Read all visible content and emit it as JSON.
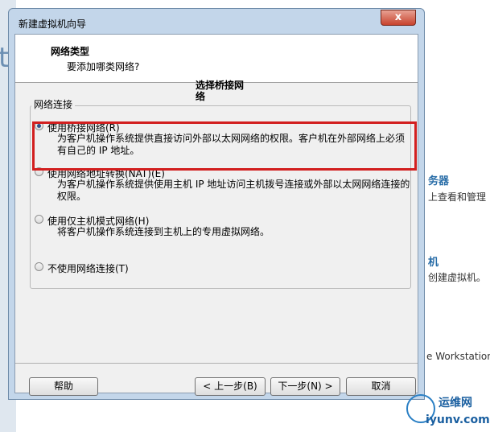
{
  "window": {
    "title": "新建虚拟机向导",
    "close_label": "x"
  },
  "header": {
    "title": "网络类型",
    "subtitle": "要添加哪类网络?"
  },
  "annotation": "选择桥接网络",
  "group": {
    "label": "网络连接"
  },
  "options": [
    {
      "label": "使用桥接网络(R)",
      "desc": "为客户机操作系统提供直接访问外部以太网网络的权限。客户机在外部网络上必须有自己的 IP 地址。",
      "checked": true
    },
    {
      "label": "使用网络地址转换(NAT)(E)",
      "desc": "为客户机操作系统提供使用主机 IP 地址访问主机拨号连接或外部以太网网络连接的权限。",
      "checked": false
    },
    {
      "label": "使用仅主机模式网络(H)",
      "desc": "将客户机操作系统连接到主机上的专用虚拟网络。",
      "checked": false
    },
    {
      "label": "不使用网络连接(T)",
      "desc": "",
      "checked": false
    }
  ],
  "buttons": {
    "help": "帮助",
    "back": "< 上一步(B)",
    "next": "下一步(N) >",
    "cancel": "取消"
  },
  "background": {
    "left_fragment": "ti",
    "right_lines": [
      "务器",
      "上查看和管理",
      "机",
      "创建虚拟机。",
      "e Workstation"
    ]
  },
  "watermark": {
    "cn": "运维网",
    "en": "iyunv.com"
  },
  "colors": {
    "highlight": "#d21f1f",
    "window_frame": "#c3d6ea",
    "dialog_bg": "#f0f0f0"
  }
}
